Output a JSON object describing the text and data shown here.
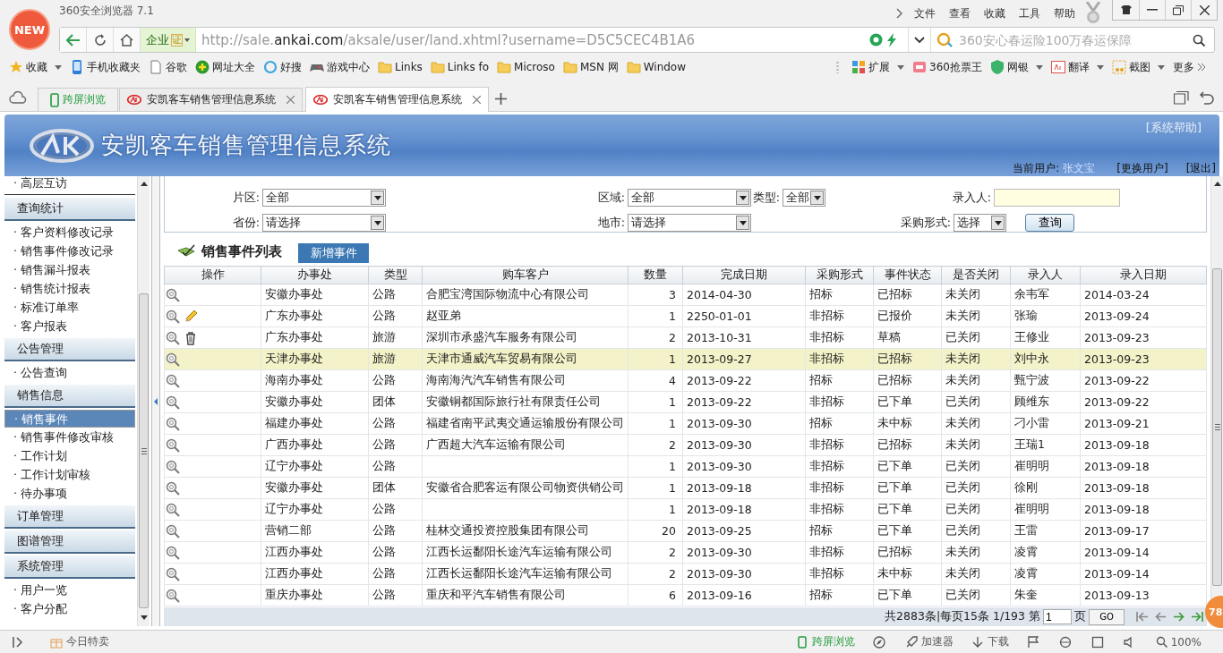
{
  "browser": {
    "logo": "NEW",
    "title": "360安全浏览器 7.1",
    "menu": [
      "文件",
      "查看",
      "收藏",
      "工具",
      "帮助"
    ],
    "badge": "企业",
    "badge_cert": "证",
    "url": {
      "prefix": "http://sale.",
      "domain": "ankai.com",
      "path": "/aksale/user/land.xhtml?username=D5C5CEC4B1A6"
    },
    "search": {
      "placeholder": "360安心春运险100万春运保障"
    },
    "bookmarks": [
      {
        "label": "收藏",
        "kind": "star",
        "dropdown": true
      },
      {
        "label": "手机收藏夹",
        "kind": "phone",
        "dropdown": false
      },
      {
        "label": "谷歌",
        "kind": "page",
        "dropdown": false
      },
      {
        "label": "网址大全",
        "kind": "plus",
        "dropdown": false
      },
      {
        "label": "好搜",
        "kind": "search",
        "dropdown": false
      },
      {
        "label": "游戏中心",
        "kind": "gamepad",
        "dropdown": false
      },
      {
        "label": "Links",
        "kind": "folder",
        "dropdown": false
      },
      {
        "label": "Links fo",
        "kind": "folder",
        "dropdown": false
      },
      {
        "label": "Microso",
        "kind": "folder",
        "dropdown": false
      },
      {
        "label": "MSN 网",
        "kind": "folder",
        "dropdown": false
      },
      {
        "label": "Window",
        "kind": "folder",
        "dropdown": false
      }
    ],
    "extensions": [
      {
        "label": "扩展",
        "kind": "grid",
        "dropdown": true
      },
      {
        "label": "360抢票王",
        "kind": "ticket",
        "dropdown": false
      },
      {
        "label": "网银",
        "kind": "shield",
        "dropdown": true
      },
      {
        "label": "翻译",
        "kind": "translate",
        "dropdown": true
      },
      {
        "label": "截图",
        "kind": "scissors",
        "dropdown": true
      },
      {
        "label": "更多",
        "kind": "more",
        "dropdown": false
      }
    ],
    "cross_screen": "跨屏浏览",
    "tabs": [
      {
        "label": "安凯客车销售管理信息系统",
        "selected": false
      },
      {
        "label": "安凯客车销售管理信息系统",
        "selected": true
      }
    ],
    "status_left": "今日特卖",
    "status_right": [
      {
        "label": "跨屏浏览",
        "kind": "phone"
      },
      {
        "label": "加速器",
        "kind": "rocket"
      },
      {
        "label": "下载",
        "kind": "download"
      }
    ],
    "zoom": "100%",
    "floating_badge": "78"
  },
  "header": {
    "title": "安凯客车销售管理信息系统",
    "help": "[系统帮助]",
    "user_label": "当前用户:",
    "user": "张文宝",
    "switch_user": "[更换用户]",
    "logout": "[退出]"
  },
  "sidebar": {
    "top_items": [
      {
        "label": "· 高层互访",
        "selected": false
      }
    ],
    "groups": [
      {
        "title": "查询统计",
        "items": [
          {
            "label": "· 客户资料修改记录",
            "selected": false
          },
          {
            "label": "· 销售事件修改记录",
            "selected": false
          },
          {
            "label": "· 销售漏斗报表",
            "selected": false
          },
          {
            "label": "· 销售统计报表",
            "selected": false
          },
          {
            "label": "· 标准订单率",
            "selected": false
          },
          {
            "label": "· 客户报表",
            "selected": false
          }
        ]
      },
      {
        "title": "公告管理",
        "items": [
          {
            "label": "· 公告查询",
            "selected": false
          }
        ]
      },
      {
        "title": "销售信息",
        "items": [
          {
            "label": "· 销售事件",
            "selected": true
          },
          {
            "label": "· 销售事件修改审核",
            "selected": false
          },
          {
            "label": "· 工作计划",
            "selected": false
          },
          {
            "label": "· 工作计划审核",
            "selected": false
          },
          {
            "label": "· 待办事项",
            "selected": false
          }
        ]
      },
      {
        "title": "订单管理"
      },
      {
        "title": "图谱管理"
      },
      {
        "title": "系统管理",
        "items": [
          {
            "label": "· 用户一览",
            "selected": false
          },
          {
            "label": "· 客户分配",
            "selected": false
          }
        ]
      }
    ]
  },
  "filters": [
    [
      {
        "label": "片区:",
        "kind": "select",
        "value": "全部"
      },
      {
        "label": "区域:",
        "kind": "select",
        "value": "全部"
      },
      {
        "label": "类型:",
        "kind": "select",
        "value": "全部"
      },
      {
        "label": "录入人:",
        "kind": "input"
      }
    ],
    [
      {
        "label": "省份:",
        "kind": "select",
        "value": "请选择"
      },
      {
        "label": "地市:",
        "kind": "select",
        "value": "请选择"
      },
      {
        "label": "采购形式:",
        "kind": "select",
        "value": "选择"
      },
      {
        "label": "查询",
        "kind": "button"
      }
    ]
  ],
  "list": {
    "title": "销售事件列表",
    "add_button": "新增事件"
  },
  "table": {
    "columns": [
      "操作",
      "办事处",
      "类型",
      "购车客户",
      "数量",
      "完成日期",
      "采购形式",
      "事件状态",
      "是否关闭",
      "录入人",
      "录入日期"
    ],
    "rows": [
      {
        "edit": false,
        "delete": false,
        "selected": false,
        "cells": [
          "",
          "安徽办事处",
          "公路",
          "合肥宝湾国际物流中心有限公司",
          "3",
          "2014-04-30",
          "招标",
          "已招标",
          "未关闭",
          "余韦军",
          "2014-03-24"
        ]
      },
      {
        "edit": true,
        "delete": false,
        "selected": false,
        "cells": [
          "",
          "广东办事处",
          "公路",
          "赵亚弟",
          "1",
          "2250-01-01",
          "非招标",
          "已报价",
          "未关闭",
          "张瑜",
          "2013-09-24"
        ]
      },
      {
        "edit": false,
        "delete": true,
        "selected": false,
        "cells": [
          "",
          "广东办事处",
          "旅游",
          "深圳市承盛汽车服务有限公司",
          "2",
          "2013-10-31",
          "非招标",
          "草稿",
          "已关闭",
          "王修业",
          "2013-09-23"
        ]
      },
      {
        "edit": false,
        "delete": false,
        "selected": true,
        "cells": [
          "",
          "天津办事处",
          "旅游",
          "天津市通威汽车贸易有限公司",
          "1",
          "2013-09-27",
          "非招标",
          "已招标",
          "未关闭",
          "刘中永",
          "2013-09-23"
        ]
      },
      {
        "edit": false,
        "delete": false,
        "selected": false,
        "cells": [
          "",
          "海南办事处",
          "公路",
          "海南海汽汽车销售有限公司",
          "4",
          "2013-09-22",
          "招标",
          "已招标",
          "未关闭",
          "甄宁波",
          "2013-09-22"
        ]
      },
      {
        "edit": false,
        "delete": false,
        "selected": false,
        "cells": [
          "",
          "安徽办事处",
          "团体",
          "安徽铜都国际旅行社有限责任公司",
          "1",
          "2013-09-22",
          "非招标",
          "已下单",
          "已关闭",
          "顾维东",
          "2013-09-22"
        ]
      },
      {
        "edit": false,
        "delete": false,
        "selected": false,
        "cells": [
          "",
          "福建办事处",
          "公路",
          "福建省南平武夷交通运输股份有限公司",
          "1",
          "2013-09-30",
          "招标",
          "未中标",
          "未关闭",
          "刁小雷",
          "2013-09-21"
        ]
      },
      {
        "edit": false,
        "delete": false,
        "selected": false,
        "cells": [
          "",
          "广西办事处",
          "公路",
          "广西超大汽车运输有限公司",
          "2",
          "2013-09-30",
          "非招标",
          "已招标",
          "未关闭",
          "王瑞1",
          "2013-09-18"
        ]
      },
      {
        "edit": false,
        "delete": false,
        "selected": false,
        "cells": [
          "",
          "辽宁办事处",
          "公路",
          "",
          "1",
          "2013-09-30",
          "非招标",
          "已下单",
          "已关闭",
          "崔明明",
          "2013-09-18"
        ]
      },
      {
        "edit": false,
        "delete": false,
        "selected": false,
        "cells": [
          "",
          "安徽办事处",
          "团体",
          "安徽省合肥客运有限公司物资供销公司",
          "1",
          "2013-09-18",
          "非招标",
          "已下单",
          "已关闭",
          "徐刚",
          "2013-09-18"
        ]
      },
      {
        "edit": false,
        "delete": false,
        "selected": false,
        "cells": [
          "",
          "辽宁办事处",
          "公路",
          "",
          "1",
          "2013-09-18",
          "非招标",
          "已下单",
          "已关闭",
          "崔明明",
          "2013-09-18"
        ]
      },
      {
        "edit": false,
        "delete": false,
        "selected": false,
        "cells": [
          "",
          "营销二部",
          "公路",
          "桂林交通投资控股集团有限公司",
          "20",
          "2013-09-25",
          "招标",
          "已下单",
          "已关闭",
          "王雷",
          "2013-09-17"
        ]
      },
      {
        "edit": false,
        "delete": false,
        "selected": false,
        "cells": [
          "",
          "江西办事处",
          "公路",
          "江西长运鄱阳长途汽车运输有限公司",
          "2",
          "2013-09-30",
          "非招标",
          "已招标",
          "未关闭",
          "凌霄",
          "2013-09-14"
        ]
      },
      {
        "edit": false,
        "delete": false,
        "selected": false,
        "cells": [
          "",
          "江西办事处",
          "公路",
          "江西长运鄱阳长途汽车运输有限公司",
          "2",
          "2013-09-30",
          "非招标",
          "未中标",
          "未关闭",
          "凌霄",
          "2013-09-14"
        ]
      },
      {
        "edit": false,
        "delete": false,
        "selected": false,
        "cells": [
          "",
          "重庆办事处",
          "公路",
          "重庆和平汽车销售有限公司",
          "6",
          "2013-09-16",
          "招标",
          "已下单",
          "已关闭",
          "朱奎",
          "2013-09-13"
        ]
      }
    ]
  },
  "pager": {
    "summary": "共2883条|每页15条 1/193 第",
    "page": "1",
    "suffix": "页",
    "go": "GO"
  }
}
